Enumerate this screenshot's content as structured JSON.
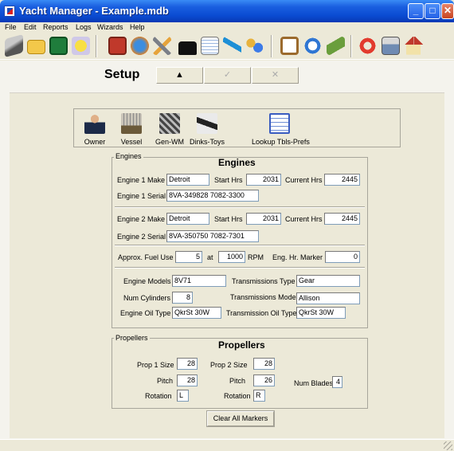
{
  "window": {
    "title": "Yacht Manager - Example.mdb",
    "minimize_glyph": "_",
    "maximize_glyph": "□",
    "close_glyph": "✕"
  },
  "menu": [
    "File",
    "Edit",
    "Reports",
    "Logs",
    "Wizards",
    "Help"
  ],
  "toolbar": {
    "icons": [
      "book-icon",
      "folder-open-icon",
      "save-disk-icon",
      "star-icon",
      "checklist-icon",
      "globe-icon",
      "wrench-icon",
      "padlock-icon",
      "notepad-icon",
      "jet-ski-icon",
      "people-icon",
      "clipboard-icon",
      "gauge-icon",
      "money-icon",
      "lifebuoy-icon",
      "printer-icon",
      "house-icon"
    ]
  },
  "form": {
    "title": "Setup",
    "nav": {
      "up": "▲",
      "check": "✓",
      "cancel": "✕"
    },
    "categories": [
      "Owner",
      "Vessel",
      "Gen-WM",
      "Dinks-Toys",
      "Lookup Tbls-Prefs"
    ]
  },
  "engines": {
    "caption": "Engines",
    "title": "Engines",
    "engine1": {
      "make_label": "Engine 1 Make",
      "make": "Detroit",
      "start_label": "Start Hrs",
      "start_hrs": "2031",
      "current_label": "Current Hrs",
      "current_hrs": "2445",
      "serial_label": "Engine 1 Serial",
      "serial": "8VA-349828 7082-3300"
    },
    "engine2": {
      "make_label": "Engine 2 Make",
      "make": "Detroit",
      "start_label": "Start Hrs",
      "start_hrs": "2031",
      "current_label": "Current Hrs",
      "current_hrs": "2445",
      "serial_label": "Engine 2 Serial",
      "serial": "8VA-350750 7082-7301"
    },
    "fuel": {
      "label": "Approx. Fuel Use",
      "value": "5",
      "at_label": "at",
      "rpm_value": "1000",
      "rpm_label": "RPM",
      "marker_label": "Eng. Hr. Marker",
      "marker_value": "0"
    },
    "details": {
      "models_label": "Engine Models",
      "models": "8V71",
      "trans_type_label": "Transmissions Type",
      "trans_type": "Gear",
      "cylinders_label": "Num Cylinders",
      "cylinders": "8",
      "trans_model_label": "Transmissions Model",
      "trans_model": "Allison",
      "oil_label": "Engine Oil Type",
      "oil": "QkrSt 30W",
      "trans_oil_label": "Transmission Oil Type",
      "trans_oil": "QkrSt 30W"
    }
  },
  "propellers": {
    "caption": "Propellers",
    "title": "Propellers",
    "prop1_size_label": "Prop 1 Size",
    "prop1_size": "28",
    "prop2_size_label": "Prop 2 Size",
    "prop2_size": "28",
    "pitch1_label": "Pitch",
    "pitch1": "28",
    "pitch2_label": "Pitch",
    "pitch2": "26",
    "blades_label": "Num Blades",
    "blades": "4",
    "rotation1_label": "Rotation",
    "rotation1": "L",
    "rotation2_label": "Rotation",
    "rotation2": "R"
  },
  "clear_button": "Clear All Markers",
  "colors": {
    "titlebar": "#0a4bd2",
    "form_bg": "#ece9d8",
    "field_border": "#7f9db9"
  }
}
